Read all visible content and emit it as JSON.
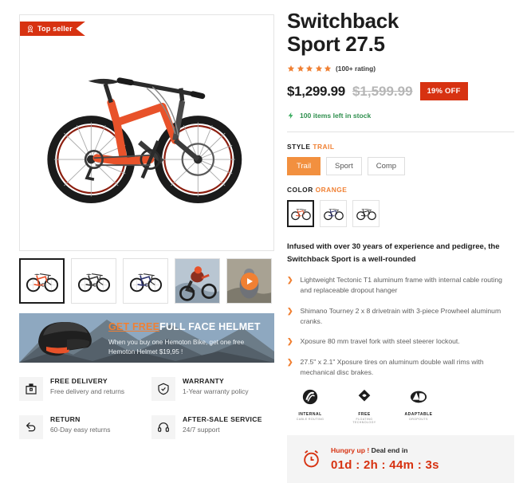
{
  "gallery": {
    "badge": {
      "label": "Top seller",
      "icon": "medal-icon",
      "bg": "#d73211"
    },
    "main_alt": "Orange full-suspension mountain bike",
    "thumbnails": [
      {
        "name": "bike-orange",
        "type": "bike",
        "color": "#e8522a",
        "selected": true
      },
      {
        "name": "bike-black",
        "type": "bike",
        "color": "#3a3a3a",
        "selected": false
      },
      {
        "name": "bike-blue",
        "type": "bike",
        "color": "#2e3470",
        "selected": false
      },
      {
        "name": "rider-action-photo",
        "type": "photo",
        "selected": false
      },
      {
        "name": "product-video",
        "type": "video",
        "selected": false
      }
    ]
  },
  "promo": {
    "heading_highlight": "GET FREE",
    "heading_rest": "FULL FACE HELMET",
    "subtext": "When you buy one Hemoton Bike, get one free Hemoton Helmet $19,95 !"
  },
  "services": [
    {
      "icon": "package-icon",
      "title": "FREE DELIVERY",
      "subtitle": "Free delivery and returns"
    },
    {
      "icon": "shield-icon",
      "title": "WARRANTY",
      "subtitle": "1-Year warranty policy"
    },
    {
      "icon": "return-arrow-icon",
      "title": "RETURN",
      "subtitle": "60-Day easy returns"
    },
    {
      "icon": "headset-icon",
      "title": "AFTER-SALE SERVICE",
      "subtitle": "24/7 support"
    }
  ],
  "product": {
    "title_line1": "Switchback",
    "title_line2": "Sport 27.5",
    "stars": 5,
    "rating_text": "(100+ rating)",
    "price_current": "$1,299.99",
    "price_original": "$1,599.99",
    "discount_badge": "19% OFF",
    "stock_text": "100 items left in stock",
    "accent_color": "#f08033",
    "sale_color": "#d73211",
    "stock_color": "#2f8f4e"
  },
  "options": {
    "style_label_prefix": "STYLE",
    "style_label_value": "TRAIL",
    "styles": [
      {
        "label": "Trail",
        "selected": true
      },
      {
        "label": "Sport",
        "selected": false
      },
      {
        "label": "Comp",
        "selected": false
      }
    ],
    "color_label_prefix": "COLOR",
    "color_label_value": "ORANGE",
    "colors": [
      {
        "name": "orange",
        "hex": "#e8522a",
        "selected": true
      },
      {
        "name": "blue",
        "hex": "#2e3470",
        "selected": false
      },
      {
        "name": "black",
        "hex": "#2b2b2b",
        "selected": false
      }
    ]
  },
  "description": "Infused with over 30 years of experience and pedigree, the Switchback Sport is a well-rounded",
  "features": [
    "Lightweight Tectonic T1 aluminum frame with internal cable routing and replaceable dropout hanger",
    "Shimano Tourney 2 x 8 drivetrain with 3-piece Prowheel aluminum cranks.",
    "Xposure 80 mm travel fork with steel steerer lockout.",
    "27.5\" x 2.1\" Xposure tires on aluminum double wall rims with mechanical disc brakes."
  ],
  "tech_badges": [
    {
      "icon": "internal-routing-icon",
      "title": "INTERNAL",
      "subtitle": "CABLE ROUTING"
    },
    {
      "icon": "free-floating-icon",
      "title": "FREE",
      "subtitle": "FLOATING TECHNOLOGY"
    },
    {
      "icon": "adaptable-icon",
      "title": "ADAPTABLE",
      "subtitle": "DROPOUTS"
    }
  ],
  "deal": {
    "icon": "alarm-clock-icon",
    "hurry_text": "Hungry up !",
    "end_text": "Deal end in",
    "timer": "01d : 2h : 44m : 3s"
  }
}
